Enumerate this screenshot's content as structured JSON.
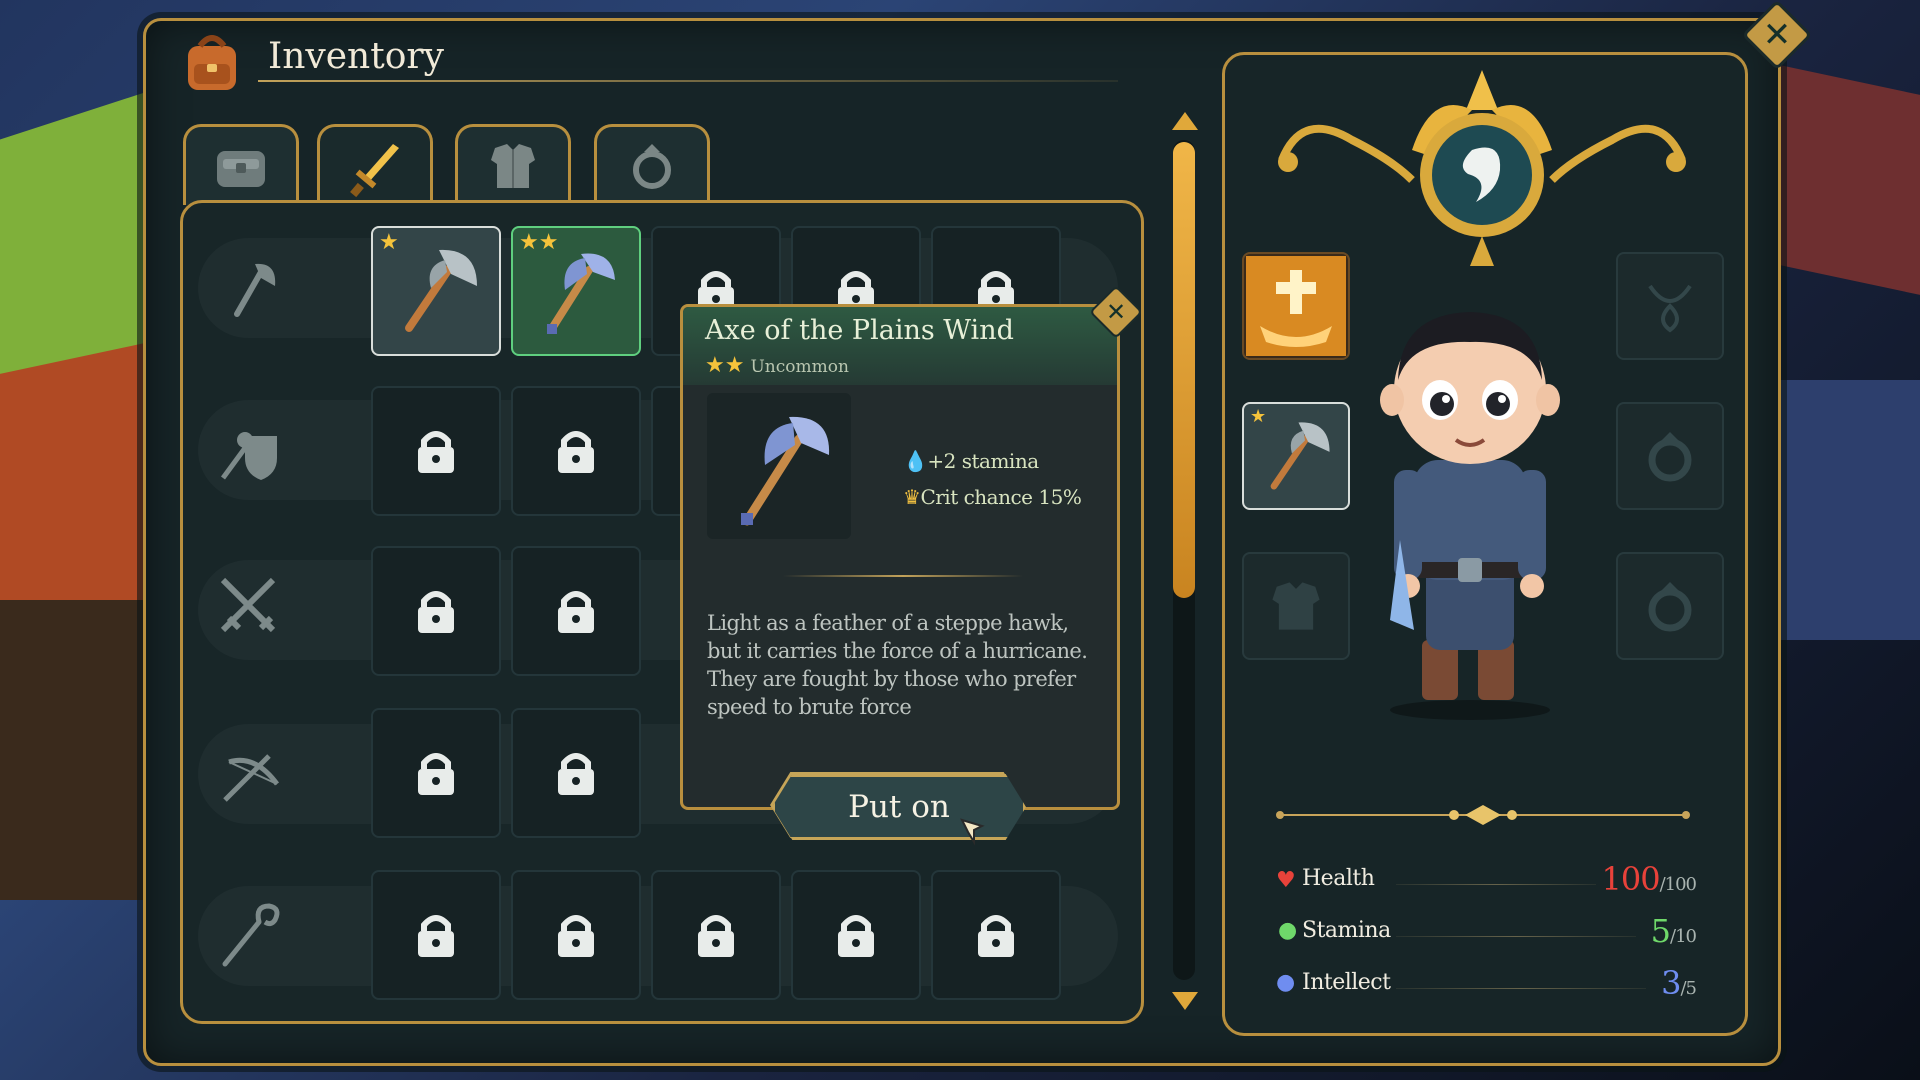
{
  "window": {
    "title": "Inventory",
    "close_icon": "close-icon"
  },
  "tabs": [
    {
      "name": "bag",
      "icon": "bag-icon",
      "active": false
    },
    {
      "name": "weapons",
      "icon": "sword-icon",
      "active": true
    },
    {
      "name": "armor",
      "icon": "armor-icon",
      "active": false
    },
    {
      "name": "rings",
      "icon": "ring-icon",
      "active": false
    }
  ],
  "categories": [
    {
      "icon": "axe-icon"
    },
    {
      "icon": "mace-shield-icon"
    },
    {
      "icon": "crossed-swords-icon"
    },
    {
      "icon": "crossbow-icon"
    },
    {
      "icon": "staff-icon"
    }
  ],
  "tooltip": {
    "title": "Axe of the Plains Wind",
    "stars": "★★",
    "rarity": "Uncommon",
    "stat1": "+2 stamina",
    "stat2": "Crit chance 15%",
    "description": "Light as a feather of a steppe hawk, but it carries the force of a hurricane. They are fought by those who prefer speed to brute force",
    "action": "Put on"
  },
  "stats": [
    {
      "label": "Health",
      "value": "100",
      "max": "/100",
      "color": "#e8423a"
    },
    {
      "label": "Stamina",
      "value": "5",
      "max": "/10",
      "color": "#6fd86a"
    },
    {
      "label": "Intellect",
      "value": "3",
      "max": "/5",
      "color": "#6f8df0"
    }
  ]
}
